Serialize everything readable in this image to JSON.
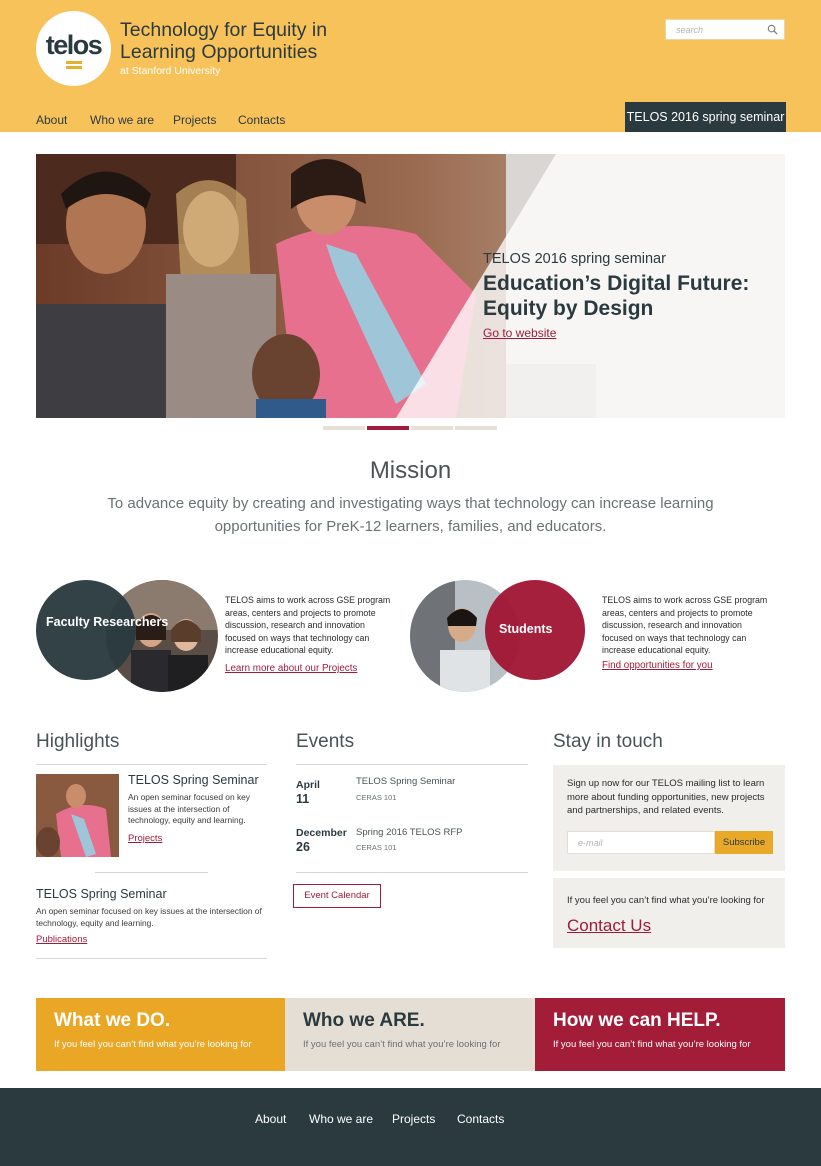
{
  "header": {
    "logo_text": "telos",
    "title": "Technology for Equity in Learning Opportunities",
    "subtitle": "at Stanford University",
    "search_placeholder": "search",
    "nav": [
      "About",
      "Who we are",
      "Projects",
      "Contacts"
    ],
    "seminar_button": "TELOS 2016 spring seminar"
  },
  "hero": {
    "kicker": "TELOS 2016 spring seminar",
    "title": "Education’s Digital Future: Equity by Design",
    "link": "Go to website",
    "slides": 4,
    "active_slide": 2
  },
  "mission": {
    "title": "Mission",
    "text": "To advance equity by creating and investigating ways that technology can increase learning opportunities for PreK-12 learners, families, and educators."
  },
  "audiences": [
    {
      "label": "Faculty Researchers",
      "text": "TELOS aims to work across GSE program areas, centers and projects to promote discussion, research and innovation focused on ways that technology can increase educational equity.",
      "link": "Learn more about our Projects"
    },
    {
      "label": "Students",
      "text": "TELOS aims to work across GSE program areas, centers and projects to promote discussion, research and innovation focused on ways that technology can increase educational equity.",
      "link": "Find opportunities for you"
    }
  ],
  "highlights": {
    "title": "Highlights",
    "items": [
      {
        "title": "TELOS Spring Seminar",
        "text": "An open seminar focused on key issues at the intersection of technology, equity and learning.",
        "link": "Projects"
      },
      {
        "title": "TELOS Spring Seminar",
        "text": "An open seminar focused on key issues at the intersection of technology, equity and learning.",
        "link": "Publications"
      }
    ]
  },
  "events": {
    "title": "Events",
    "items": [
      {
        "month": "April",
        "day": "11",
        "name": "TELOS Spring Seminar",
        "location": "CERAS 101"
      },
      {
        "month": "December",
        "day": "26",
        "name": "Spring 2016 TELOS RFP",
        "location": "CERAS 101"
      }
    ],
    "calendar_button": "Event Calendar"
  },
  "stay": {
    "title": "Stay in touch",
    "signup_text": "Sign up now for our TELOS mailing list to learn more about funding opportunities, new projects and partnerships, and related events.",
    "email_placeholder": "e-mail",
    "subscribe": "Subscribe",
    "contact_text": "If you feel you can’t find what you’re looking for",
    "contact_link": "Contact Us"
  },
  "bands": [
    {
      "title": "What we DO.",
      "sub": "If you feel you can’t find what you’re looking for",
      "bg": "#eaa726",
      "color": "#ffffff"
    },
    {
      "title": "Who we ARE.",
      "sub": "If you feel you can’t find what you’re looking for",
      "bg": "#e4ded5",
      "color": "#2b3a3f"
    },
    {
      "title": "How we can HELP.",
      "sub": "If you feel you can’t find what you’re looking for",
      "bg": "#a31c38",
      "color": "#ffffff"
    }
  ],
  "footer": {
    "nav": [
      "About",
      "Who we are",
      "Projects",
      "Contacts"
    ]
  },
  "colors": {
    "header_bg": "#f8c25a",
    "dark": "#2b3a3f",
    "accent_red": "#a01c3a",
    "accent_gold": "#eaa726"
  }
}
